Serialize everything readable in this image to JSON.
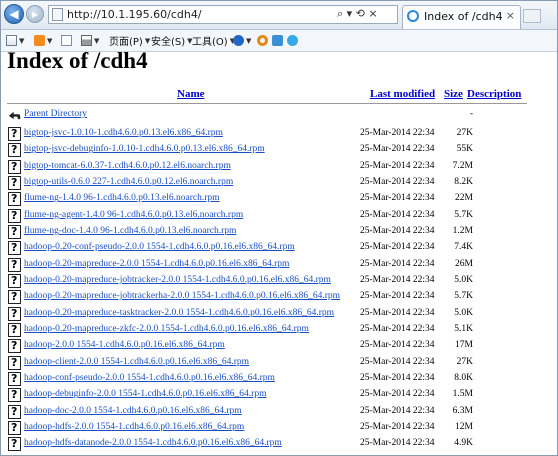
{
  "browser": {
    "address": "http://10.1.195.60/cdh4/",
    "address_controls": "⌕ ▾ ⟲ ×",
    "tab_title": "Index of /cdh4",
    "tab_close": "×",
    "back_glyph": "◀",
    "forward_glyph": "▶"
  },
  "commands": {
    "page": "页面(P)",
    "safety": "安全(S)",
    "tools": "工具(O)"
  },
  "page": {
    "title": "Index of /cdh4",
    "columns": {
      "name": "Name",
      "modified": "Last modified",
      "size": "Size",
      "description": "Description"
    },
    "parent": {
      "name": "Parent Directory",
      "size": "-"
    },
    "files": [
      {
        "name": "bigtop-jsvc-1.0.10-1.cdh4.6.0.p0.13.el6.x86_64.rpm",
        "modified": "25-Mar-2014 22:34",
        "size": "27K"
      },
      {
        "name": "bigtop-jsvc-debuginfo-1.0.10-1.cdh4.6.0.p0.13.el6.x86_64.rpm",
        "modified": "25-Mar-2014 22:34",
        "size": "55K"
      },
      {
        "name": "bigtop-tomcat-6.0.37-1.cdh4.6.0.p0.12.el6.noarch.rpm",
        "modified": "25-Mar-2014 22:34",
        "size": "7.2M"
      },
      {
        "name": "bigtop-utils-0.6.0 227-1.cdh4.6.0.p0.12.el6.noarch.rpm",
        "modified": "25-Mar-2014 22:34",
        "size": "8.2K"
      },
      {
        "name": "flume-ng-1.4.0 96-1.cdh4.6.0.p0.13.el6.noarch.rpm",
        "modified": "25-Mar-2014 22:34",
        "size": "22M"
      },
      {
        "name": "flume-ng-agent-1.4.0 96-1.cdh4.6.0.p0.13.el6.noarch.rpm",
        "modified": "25-Mar-2014 22:34",
        "size": "5.7K"
      },
      {
        "name": "flume-ng-doc-1.4.0 96-1.cdh4.6.0.p0.13.el6.noarch.rpm",
        "modified": "25-Mar-2014 22:34",
        "size": "1.2M"
      },
      {
        "name": "hadoop-0.20-conf-pseudo-2.0.0 1554-1.cdh4.6.0.p0.16.el6.x86_64.rpm",
        "modified": "25-Mar-2014 22:34",
        "size": "7.4K"
      },
      {
        "name": "hadoop-0.20-mapreduce-2.0.0 1554-1.cdh4.6.0.p0.16.el6.x86_64.rpm",
        "modified": "25-Mar-2014 22:34",
        "size": "26M"
      },
      {
        "name": "hadoop-0.20-mapreduce-jobtracker-2.0.0 1554-1.cdh4.6.0.p0.16.el6.x86_64.rpm",
        "modified": "25-Mar-2014 22:34",
        "size": "5.0K"
      },
      {
        "name": "hadoop-0.20-mapreduce-jobtrackerha-2.0.0 1554-1.cdh4.6.0.p0.16.el6.x86_64.rpm",
        "modified": "25-Mar-2014 22:34",
        "size": "5.7K"
      },
      {
        "name": "hadoop-0.20-mapreduce-tasktracker-2.0.0 1554-1.cdh4.6.0.p0.16.el6.x86_64.rpm",
        "modified": "25-Mar-2014 22:34",
        "size": "5.0K"
      },
      {
        "name": "hadoop-0.20-mapreduce-zkfc-2.0.0 1554-1.cdh4.6.0.p0.16.el6.x86_64.rpm",
        "modified": "25-Mar-2014 22:34",
        "size": "5.1K"
      },
      {
        "name": "hadoop-2.0.0 1554-1.cdh4.6.0.p0.16.el6.x86_64.rpm",
        "modified": "25-Mar-2014 22:34",
        "size": "17M"
      },
      {
        "name": "hadoop-client-2.0.0 1554-1.cdh4.6.0.p0.16.el6.x86_64.rpm",
        "modified": "25-Mar-2014 22:34",
        "size": "27K"
      },
      {
        "name": "hadoop-conf-pseudo-2.0.0 1554-1.cdh4.6.0.p0.16.el6.x86_64.rpm",
        "modified": "25-Mar-2014 22:34",
        "size": "8.0K"
      },
      {
        "name": "hadoop-debuginfo-2.0.0 1554-1.cdh4.6.0.p0.16.el6.x86_64.rpm",
        "modified": "25-Mar-2014 22:34",
        "size": "1.5M"
      },
      {
        "name": "hadoop-doc-2.0.0 1554-1.cdh4.6.0.p0.16.el6.x86_64.rpm",
        "modified": "25-Mar-2014 22:34",
        "size": "6.3M"
      },
      {
        "name": "hadoop-hdfs-2.0.0 1554-1.cdh4.6.0.p0.16.el6.x86_64.rpm",
        "modified": "25-Mar-2014 22:34",
        "size": "12M"
      },
      {
        "name": "hadoop-hdfs-datanode-2.0.0 1554-1.cdh4.6.0.p0.16.el6.x86_64.rpm",
        "modified": "25-Mar-2014 22:34",
        "size": "4.9K"
      }
    ]
  }
}
